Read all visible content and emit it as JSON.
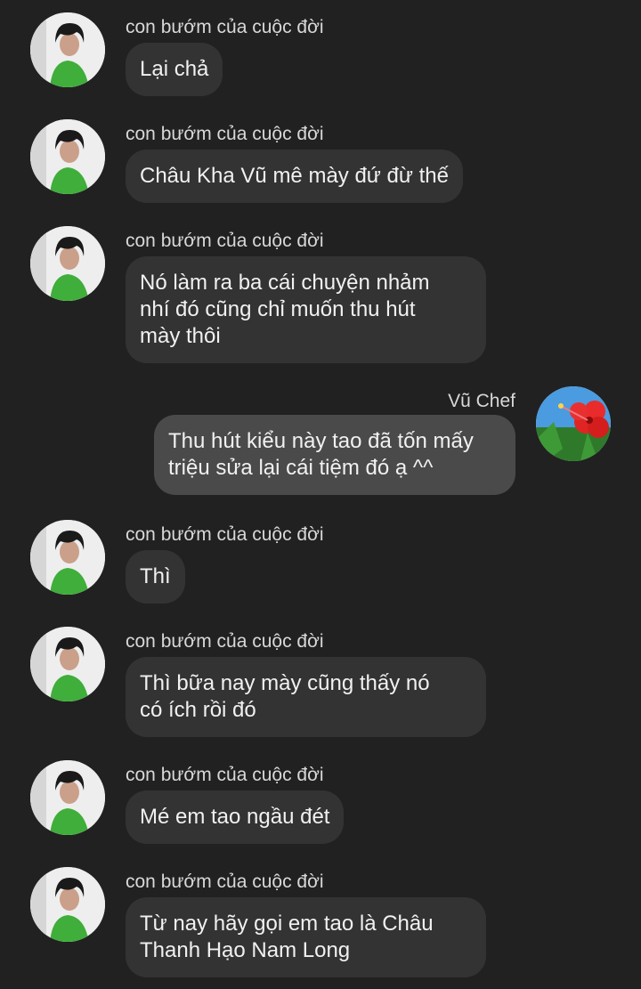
{
  "chat": {
    "messages": [
      {
        "sender": "con bướm của cuộc đời",
        "lines": [
          "Lại chả"
        ]
      },
      {
        "sender": "con bướm của cuộc đời",
        "lines": [
          "Châu Kha Vũ mê mày đứ đừ thế"
        ]
      },
      {
        "sender": "con bướm của cuộc đời",
        "lines": [
          "Nó làm ra ba cái chuyện nhảm",
          "nhí đó cũng chỉ muốn thu hút",
          "mày thôi"
        ]
      },
      {
        "sender": "Vũ Chef",
        "lines": [
          "Thu hút kiểu này tao đã tốn mấy",
          "triệu sửa lại cái tiệm đó ạ ^^"
        ]
      },
      {
        "sender": "con bướm của cuộc đời",
        "lines": [
          "Thì"
        ]
      },
      {
        "sender": "con bướm của cuộc đời",
        "lines": [
          "Thì bữa nay mày cũng thấy nó",
          "có ích rồi đó"
        ]
      },
      {
        "sender": "con bướm của cuộc đời",
        "lines": [
          "Mé em tao ngầu đét"
        ]
      },
      {
        "sender": "con bướm của cuộc đời",
        "lines": [
          "Từ nay hãy gọi em tao là Châu",
          "Thanh Hạo Nam Long"
        ]
      }
    ]
  },
  "icons": {
    "other_avatar": "person-avatar-icon",
    "self_avatar": "hibiscus-flower-avatar-icon"
  },
  "colors": {
    "background": "#212121",
    "bubble_other": "#333333",
    "bubble_self": "#4a4a4a",
    "text": "#f1f1f1",
    "sender_name": "#d8d8d8"
  }
}
